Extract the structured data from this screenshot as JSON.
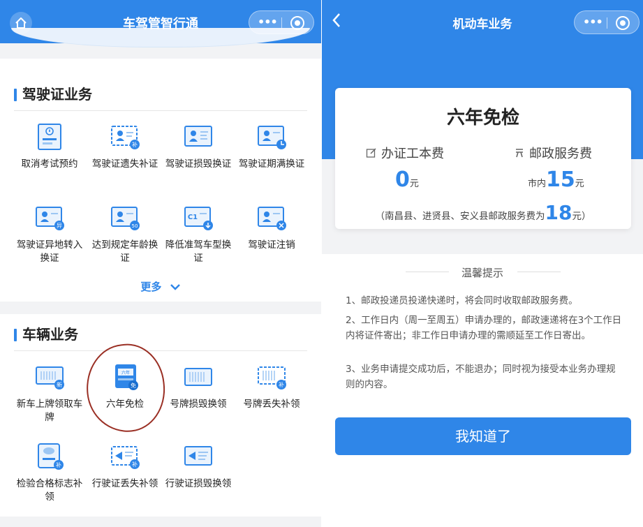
{
  "left": {
    "nav_title": "车驾管智行通",
    "license_section": {
      "title": "驾驶证业务",
      "items": [
        {
          "label": "取消考试预约",
          "icon": "cancel-exam-icon"
        },
        {
          "label": "驾驶证遗失补证",
          "icon": "license-lost-icon"
        },
        {
          "label": "驾驶证损毁换证",
          "icon": "license-damaged-icon"
        },
        {
          "label": "驾驶证期满换证",
          "icon": "license-expiry-icon"
        },
        {
          "label": "驾驶证异地转入换证",
          "icon": "license-transfer-icon"
        },
        {
          "label": "达到规定年龄换证",
          "icon": "license-age-icon"
        },
        {
          "label": "降低准驾车型换证",
          "icon": "license-downgrade-icon"
        },
        {
          "label": "驾驶证注销",
          "icon": "license-cancel-icon"
        }
      ],
      "more_label": "更多"
    },
    "vehicle_section": {
      "title": "车辆业务",
      "items": [
        {
          "label": "新车上牌领取车牌",
          "icon": "new-plate-icon"
        },
        {
          "label": "六年免检",
          "icon": "six-year-exempt-icon"
        },
        {
          "label": "号牌损毁换领",
          "icon": "plate-damaged-icon"
        },
        {
          "label": "号牌丢失补领",
          "icon": "plate-lost-icon"
        },
        {
          "label": "检验合格标志补领",
          "icon": "inspection-mark-icon"
        },
        {
          "label": "行驶证丢失补领",
          "icon": "vehicle-license-lost-icon"
        },
        {
          "label": "行驶证损毁换领",
          "icon": "vehicle-license-damaged-icon"
        }
      ]
    }
  },
  "right": {
    "nav_title": "机动车业务",
    "card": {
      "title": "六年免检",
      "fee1_label": "办证工本费",
      "fee1_value": "0",
      "fee1_unit": "元",
      "fee2_label": "邮政服务费",
      "fee2_prefix": "市内",
      "fee2_value": "15",
      "fee2_unit": "元",
      "note_prefix": "（南昌县、进贤县、安义县邮政服务费为",
      "note_value": "18",
      "note_suffix": "元）"
    },
    "tips_title": "温馨提示",
    "tips": [
      "1、邮政投递员投递快递时，将会同时收取邮政服务费。",
      "2、工作日内（周一至周五）申请办理的，邮政速递将在3个工作日内将证件寄出；非工作日申请办理的需顺延至工作日寄出。",
      "3、业务申请提交成功后，不能退办；同时视为接受本业务办理规则的内容。"
    ],
    "ok_label": "我知道了"
  },
  "colors": {
    "primary": "#2f86e8",
    "annotation": "#9a2f24"
  }
}
